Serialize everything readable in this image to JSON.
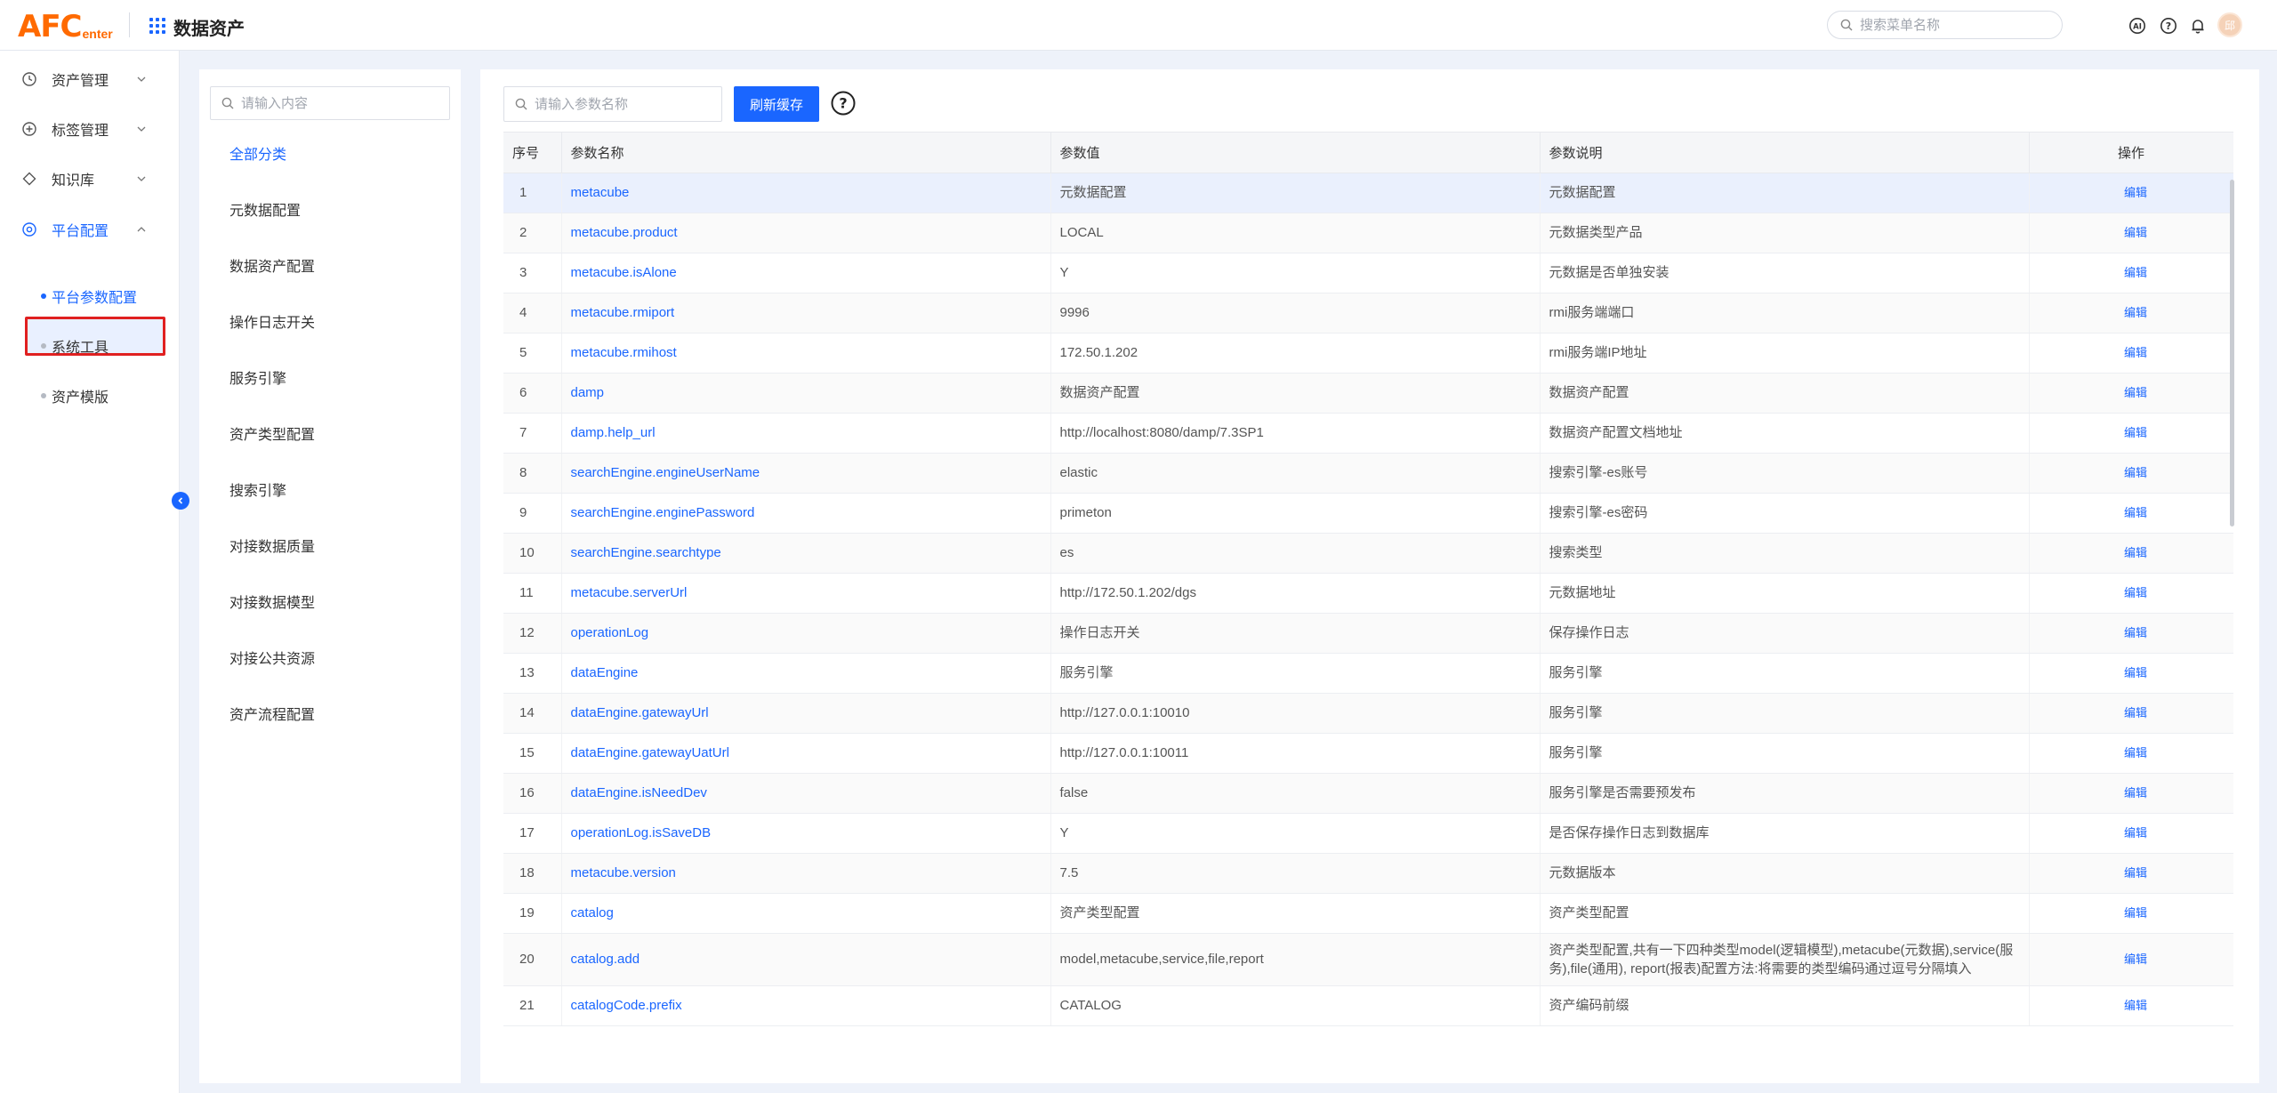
{
  "header": {
    "logo_big": "AFC",
    "logo_small": "enter",
    "app_title": "数据资产",
    "search_placeholder": "搜索菜单名称",
    "avatar_text": "邱"
  },
  "sidebar": {
    "items": [
      {
        "label": "资产管理",
        "icon": "clock-icon"
      },
      {
        "label": "标签管理",
        "icon": "plus-circle-icon"
      },
      {
        "label": "知识库",
        "icon": "diamond-icon"
      },
      {
        "label": "平台配置",
        "icon": "target-icon"
      }
    ],
    "sub_items": [
      {
        "label": "平台参数配置"
      },
      {
        "label": "系统工具"
      },
      {
        "label": "资产模版"
      }
    ]
  },
  "categories": {
    "search_placeholder": "请输入内容",
    "items": [
      "全部分类",
      "元数据配置",
      "数据资产配置",
      "操作日志开关",
      "服务引擎",
      "资产类型配置",
      "搜索引擎",
      "对接数据质量",
      "对接数据模型",
      "对接公共资源",
      "资产流程配置"
    ]
  },
  "toolbar": {
    "search_placeholder": "请输入参数名称",
    "refresh_label": "刷新缓存"
  },
  "table": {
    "headers": {
      "idx": "序号",
      "name": "参数名称",
      "value": "参数值",
      "desc": "参数说明",
      "op": "操作"
    },
    "edit_label": "编辑",
    "rows": [
      {
        "idx": "1",
        "name": "metacube",
        "value": "元数据配置",
        "desc": "元数据配置"
      },
      {
        "idx": "2",
        "name": "metacube.product",
        "value": "LOCAL",
        "desc": "元数据类型产品"
      },
      {
        "idx": "3",
        "name": "metacube.isAlone",
        "value": "Y",
        "desc": "元数据是否单独安装"
      },
      {
        "idx": "4",
        "name": "metacube.rmiport",
        "value": "9996",
        "desc": "rmi服务端端口"
      },
      {
        "idx": "5",
        "name": "metacube.rmihost",
        "value": "172.50.1.202",
        "desc": "rmi服务端IP地址"
      },
      {
        "idx": "6",
        "name": "damp",
        "value": "数据资产配置",
        "desc": "数据资产配置"
      },
      {
        "idx": "7",
        "name": "damp.help_url",
        "value": "http://localhost:8080/damp/7.3SP1",
        "desc": "数据资产配置文档地址"
      },
      {
        "idx": "8",
        "name": "searchEngine.engineUserName",
        "value": "elastic",
        "desc": "搜索引擎-es账号"
      },
      {
        "idx": "9",
        "name": "searchEngine.enginePassword",
        "value": "primeton",
        "desc": "搜索引擎-es密码"
      },
      {
        "idx": "10",
        "name": "searchEngine.searchtype",
        "value": "es",
        "desc": "搜索类型"
      },
      {
        "idx": "11",
        "name": "metacube.serverUrl",
        "value": "http://172.50.1.202/dgs",
        "desc": "元数据地址"
      },
      {
        "idx": "12",
        "name": "operationLog",
        "value": "操作日志开关",
        "desc": "保存操作日志"
      },
      {
        "idx": "13",
        "name": "dataEngine",
        "value": "服务引擎",
        "desc": "服务引擎"
      },
      {
        "idx": "14",
        "name": "dataEngine.gatewayUrl",
        "value": "http://127.0.0.1:10010",
        "desc": "服务引擎"
      },
      {
        "idx": "15",
        "name": "dataEngine.gatewayUatUrl",
        "value": "http://127.0.0.1:10011",
        "desc": "服务引擎"
      },
      {
        "idx": "16",
        "name": "dataEngine.isNeedDev",
        "value": "false",
        "desc": "服务引擎是否需要预发布"
      },
      {
        "idx": "17",
        "name": "operationLog.isSaveDB",
        "value": "Y",
        "desc": "是否保存操作日志到数据库"
      },
      {
        "idx": "18",
        "name": "metacube.version",
        "value": "7.5",
        "desc": "元数据版本"
      },
      {
        "idx": "19",
        "name": "catalog",
        "value": "资产类型配置",
        "desc": "资产类型配置"
      },
      {
        "idx": "20",
        "name": "catalog.add",
        "value": "model,metacube,service,file,report",
        "desc": "资产类型配置,共有一下四种类型model(逻辑模型),metacube(元数据),service(服务),file(通用), report(报表)配置方法:将需要的类型编码通过逗号分隔填入"
      },
      {
        "idx": "21",
        "name": "catalogCode.prefix",
        "value": "CATALOG",
        "desc": "资产编码前缀"
      }
    ]
  }
}
